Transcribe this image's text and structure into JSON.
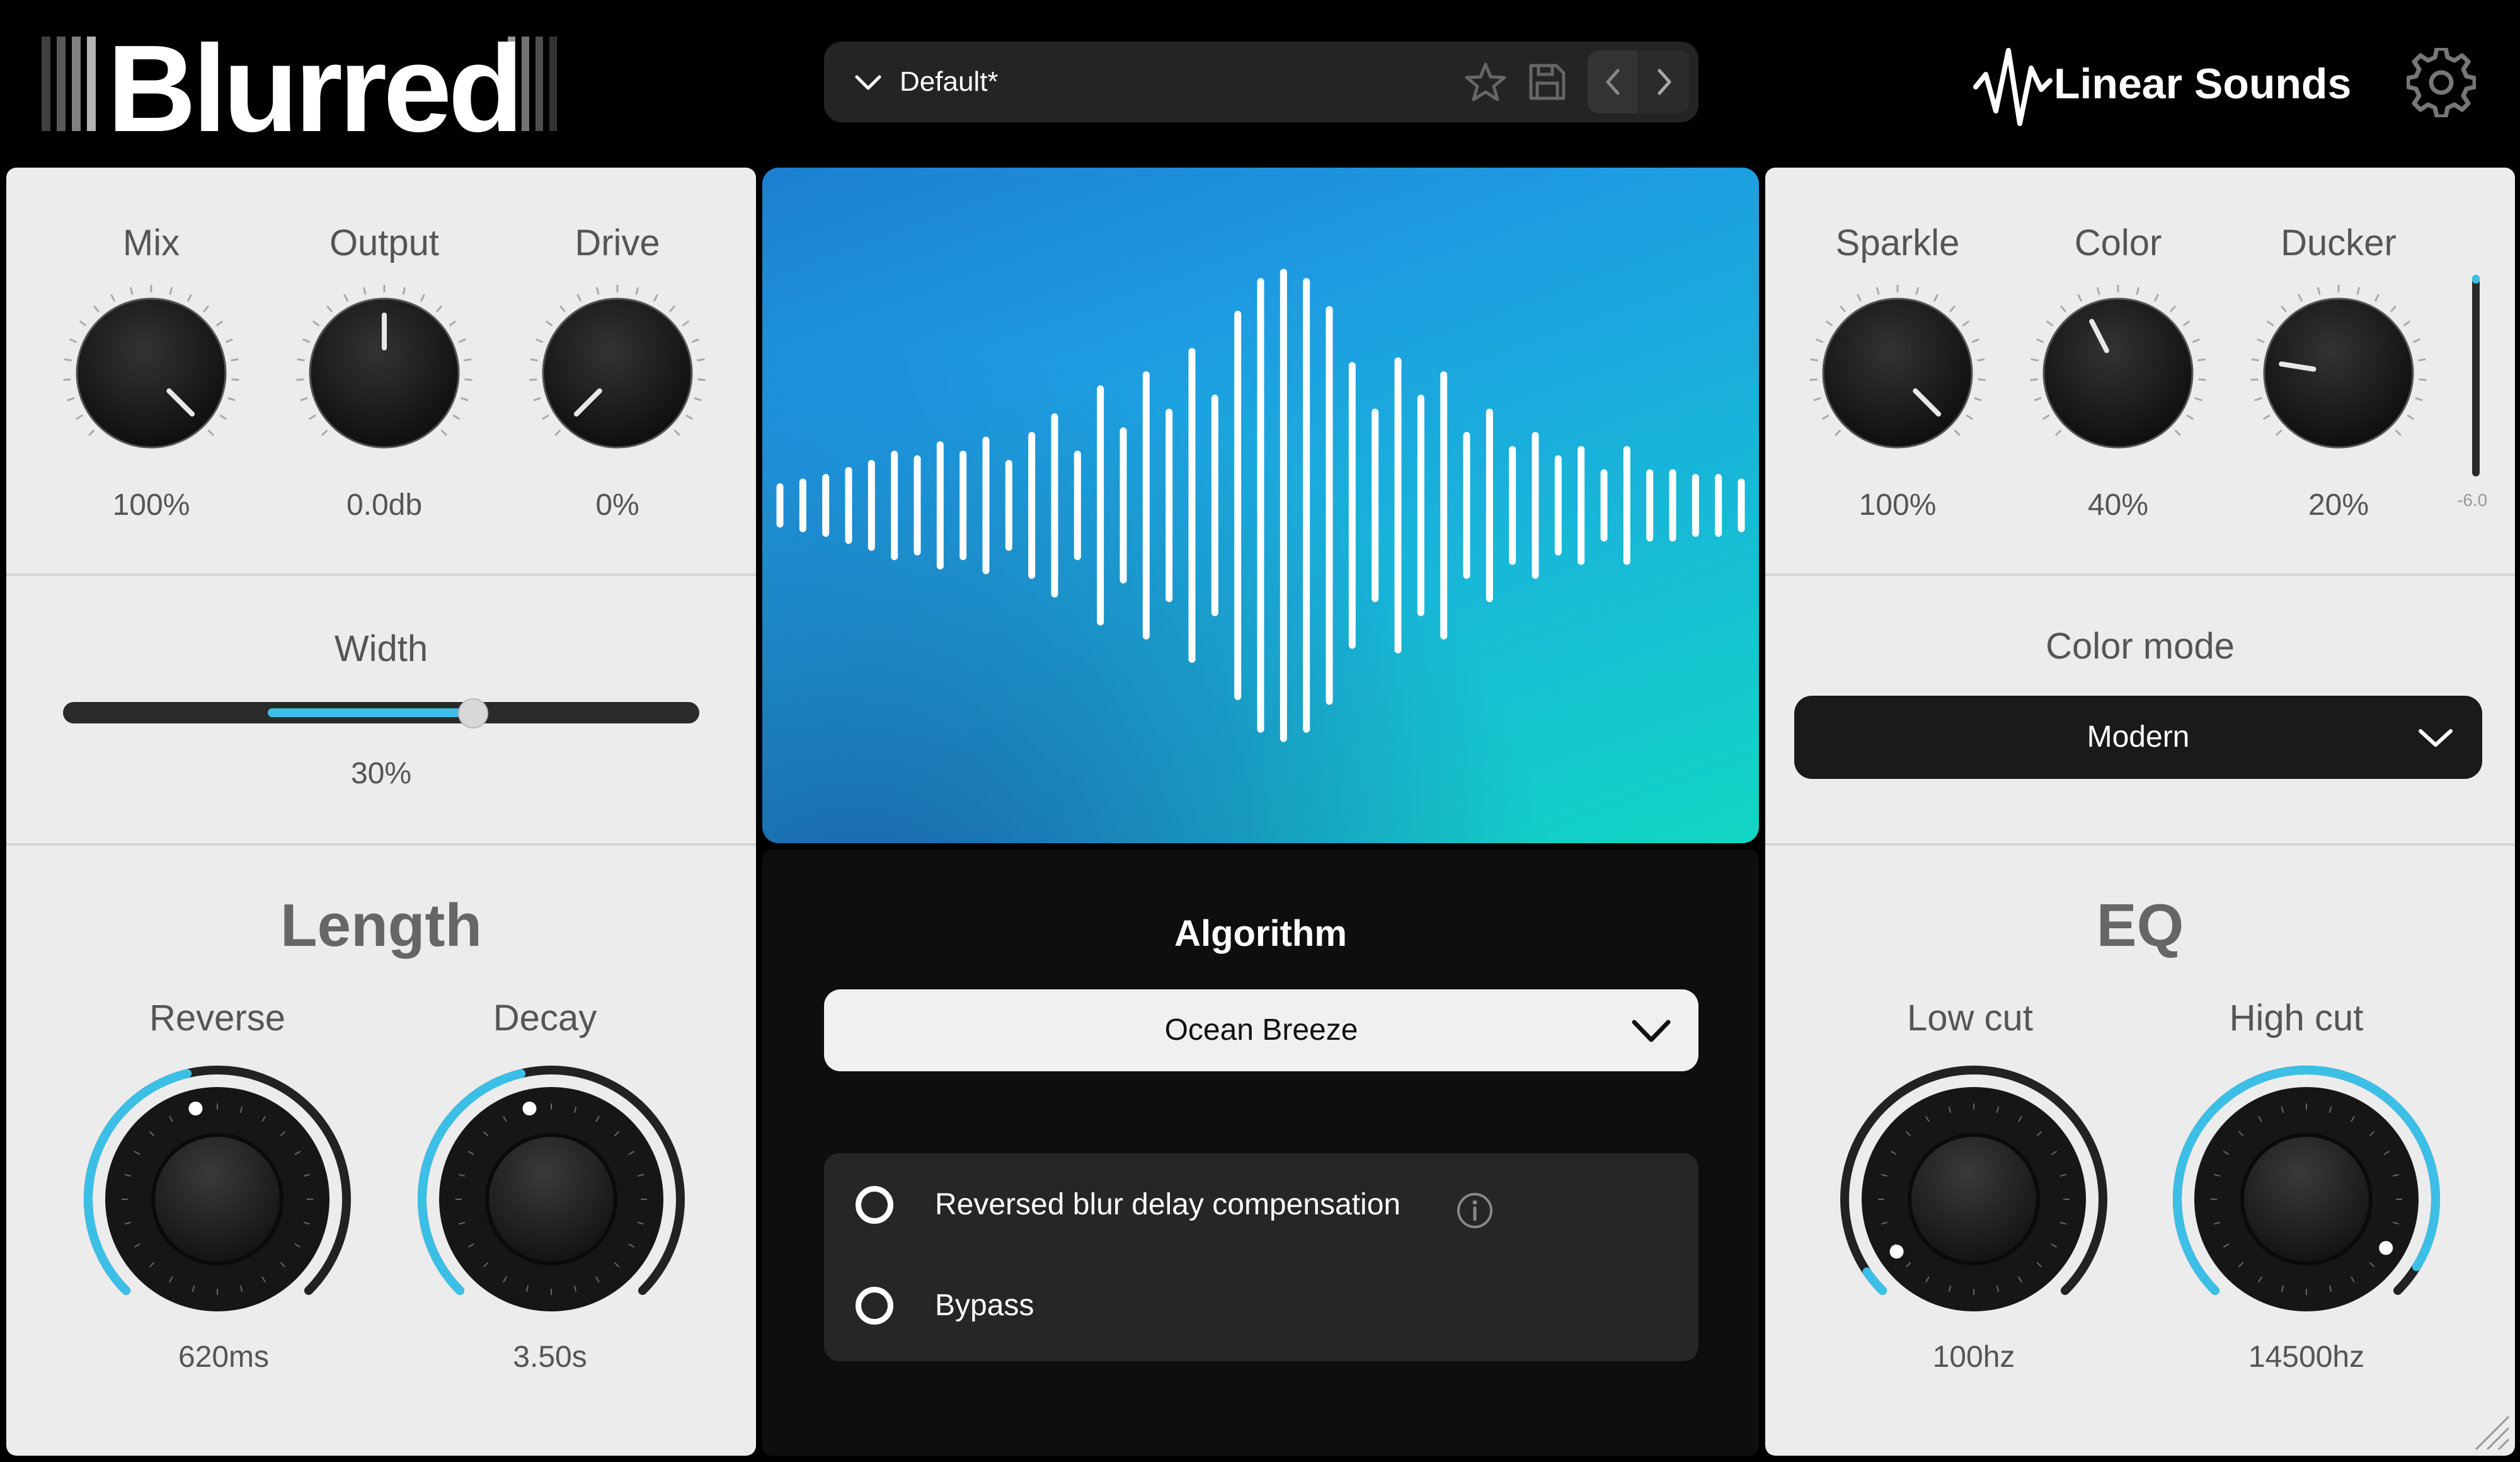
{
  "app": {
    "title": "Blurred",
    "brand": "Linear Sounds"
  },
  "preset": {
    "name": "Default*"
  },
  "left_panel": {
    "knobs": [
      {
        "label": "Mix",
        "value": "100%",
        "level": 1.0
      },
      {
        "label": "Output",
        "value": "0.0db",
        "level": 0.5
      },
      {
        "label": "Drive",
        "value": "0%",
        "level": 0.0
      }
    ],
    "width": {
      "label": "Width",
      "value": "30%",
      "level": 0.3
    },
    "length": {
      "title": "Length",
      "knobs": [
        {
          "label": "Reverse",
          "value": "620ms",
          "level": 0.45
        },
        {
          "label": "Decay",
          "value": "3.50s",
          "level": 0.45
        }
      ]
    }
  },
  "center": {
    "waveform_bars": [
      0.08,
      0.1,
      0.12,
      0.15,
      0.18,
      0.22,
      0.2,
      0.26,
      0.22,
      0.28,
      0.18,
      0.3,
      0.38,
      0.22,
      0.5,
      0.32,
      0.56,
      0.4,
      0.66,
      0.46,
      0.82,
      0.96,
      1.0,
      0.96,
      0.84,
      0.6,
      0.4,
      0.62,
      0.46,
      0.56,
      0.3,
      0.4,
      0.24,
      0.3,
      0.2,
      0.24,
      0.14,
      0.24,
      0.14,
      0.14,
      0.12,
      0.12,
      0.1
    ],
    "algorithm": {
      "title": "Algorithm",
      "selected": "Ocean Breeze"
    },
    "options": [
      {
        "label": "Reversed blur delay compensation",
        "checked": false
      },
      {
        "label": "Bypass",
        "checked": false
      }
    ]
  },
  "right_panel": {
    "knobs": [
      {
        "label": "Sparkle",
        "value": "100%",
        "level": 1.0
      },
      {
        "label": "Color",
        "value": "40%",
        "level": 0.4
      },
      {
        "label": "Ducker",
        "value": "20%",
        "level": 0.2
      }
    ],
    "meter": {
      "label": "-6.0"
    },
    "color_mode": {
      "label": "Color mode",
      "selected": "Modern"
    },
    "eq": {
      "title": "EQ",
      "knobs": [
        {
          "label": "Low cut",
          "value": "100hz",
          "level": 0.04
        },
        {
          "label": "High cut",
          "value": "14500hz",
          "level": 0.95
        }
      ]
    }
  },
  "colors": {
    "accent": "#3cbfe6",
    "panel": "#ececec",
    "knob": "#1b1b1b"
  }
}
